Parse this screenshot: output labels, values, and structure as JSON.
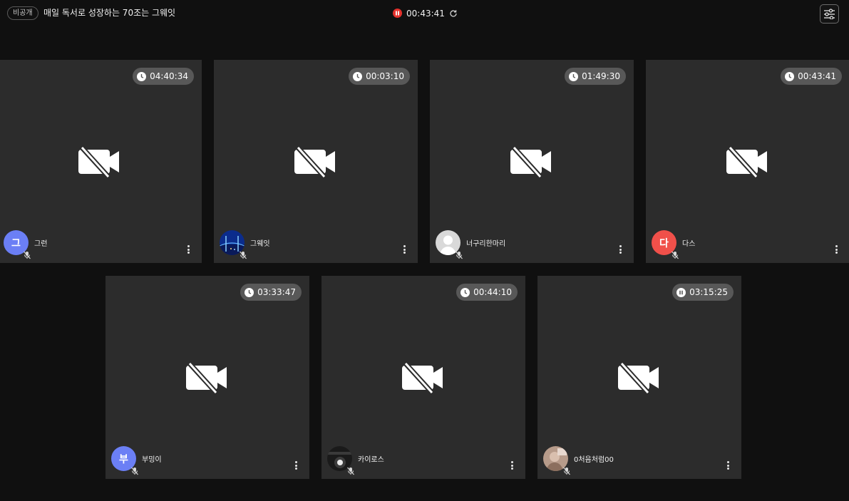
{
  "header": {
    "visibility_badge": "비공개",
    "room_title": "매일 독서로 성장하는 70조는 그웨잇",
    "session_timer": "00:43:41",
    "rec_color": "#e5322d"
  },
  "participants": [
    {
      "name": "그런",
      "time": "04:40:34",
      "timer_icon": "clock-icon",
      "avatar": {
        "type": "initial",
        "text": "그",
        "color": "#6b7ff5"
      }
    },
    {
      "name": "그웨잇",
      "time": "00:03:10",
      "timer_icon": "clock-icon",
      "avatar": {
        "type": "image",
        "desc": "blue-night-bridge"
      }
    },
    {
      "name": "너구리한마리",
      "time": "01:49:30",
      "timer_icon": "clock-icon",
      "avatar": {
        "type": "image",
        "desc": "default-gray-person"
      }
    },
    {
      "name": "다스",
      "time": "00:43:41",
      "timer_icon": "clock-icon",
      "avatar": {
        "type": "initial",
        "text": "다",
        "color": "#f0504a"
      }
    },
    {
      "name": "부밍이",
      "time": "03:33:47",
      "timer_icon": "clock-icon",
      "avatar": {
        "type": "initial",
        "text": "부",
        "color": "#6b7ff5"
      }
    },
    {
      "name": "카이로스",
      "time": "00:44:10",
      "timer_icon": "clock-icon",
      "avatar": {
        "type": "image",
        "desc": "dark-moon-photo"
      }
    },
    {
      "name": "0처음처럼00",
      "time": "03:15:25",
      "timer_icon": "pause-icon",
      "avatar": {
        "type": "image",
        "desc": "person-photo"
      }
    }
  ]
}
